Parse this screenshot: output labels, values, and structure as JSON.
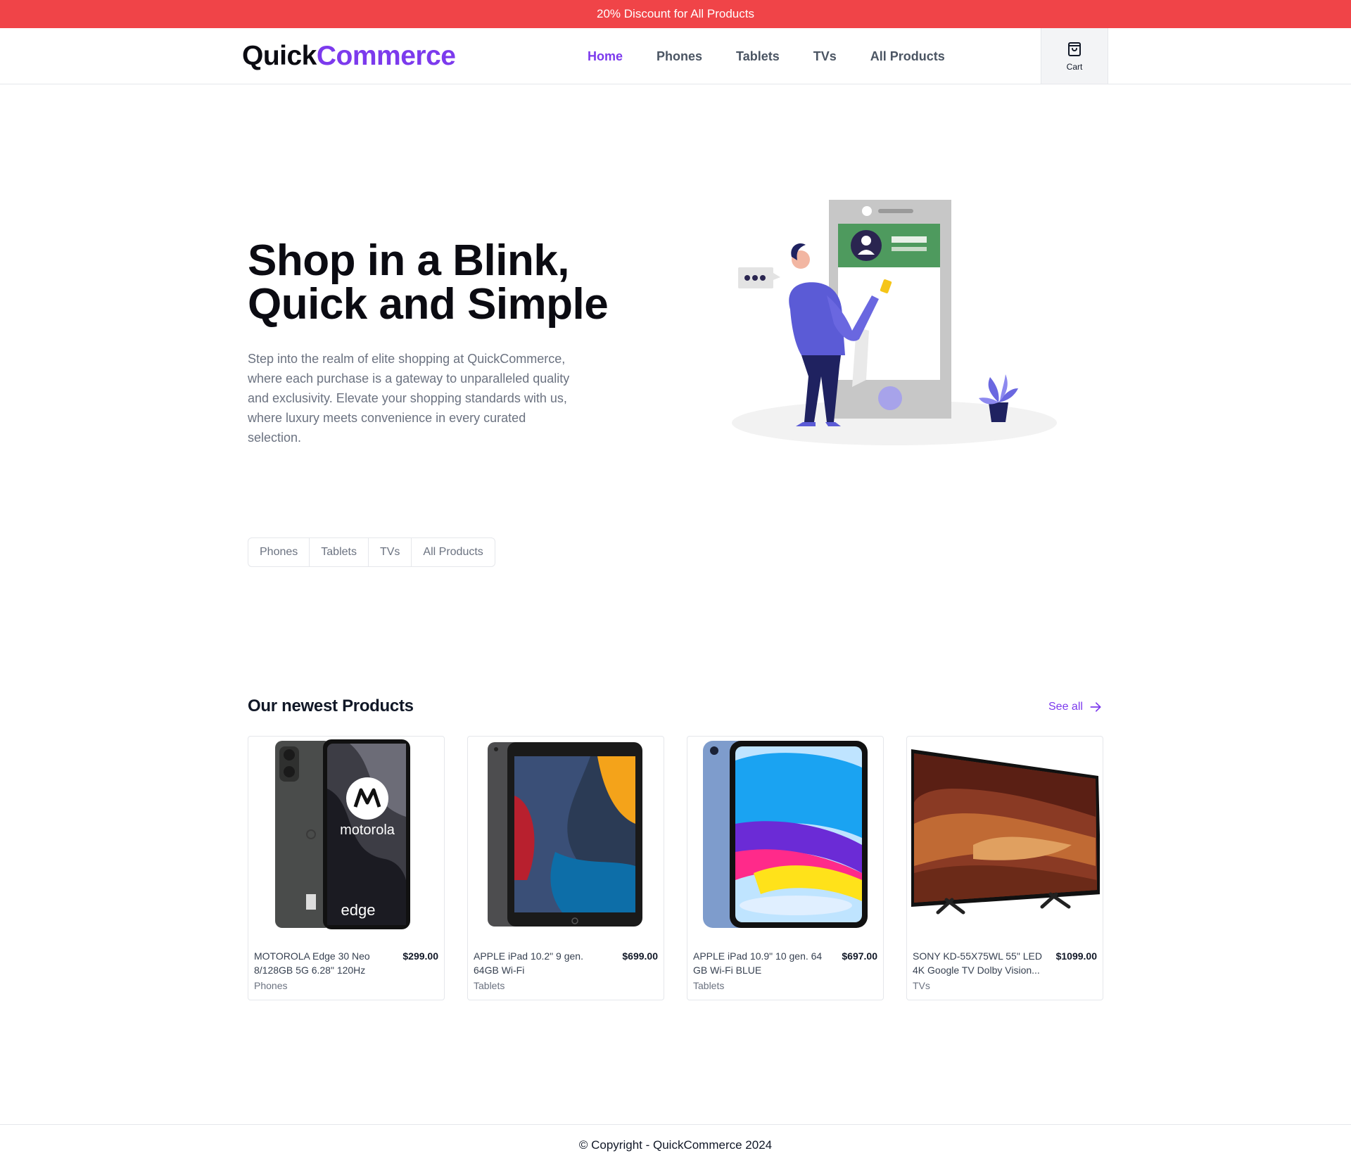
{
  "banner": {
    "text": "20% Discount for All Products"
  },
  "header": {
    "logo_part1": "Quick",
    "logo_part2": "Commerce",
    "nav": [
      {
        "label": "Home",
        "active": true
      },
      {
        "label": "Phones"
      },
      {
        "label": "Tablets"
      },
      {
        "label": "TVs"
      },
      {
        "label": "All Products"
      }
    ],
    "cart_label": "Cart",
    "cart_icon": "shopping-bag-icon"
  },
  "hero": {
    "title_line1": "Shop in a Blink,",
    "title_line2": "Quick and Simple",
    "description": "Step into the realm of elite shopping at QuickCommerce, where each purchase is a gateway to unparalleled quality and exclusivity. Elevate your shopping standards with us, where luxury meets convenience in every curated selection."
  },
  "categories": [
    "Phones",
    "Tablets",
    "TVs",
    "All Products"
  ],
  "newest": {
    "title": "Our newest Products",
    "see_all": "See all",
    "products": [
      {
        "name": "MOTOROLA Edge 30 Neo 8/128GB 5G 6.28\" 120Hz",
        "price": "$299.00",
        "category": "Phones"
      },
      {
        "name": "APPLE iPad 10.2\" 9 gen. 64GB Wi-Fi",
        "price": "$699.00",
        "category": "Tablets"
      },
      {
        "name": "APPLE iPad 10.9\" 10 gen. 64 GB Wi-Fi BLUE",
        "price": "$697.00",
        "category": "Tablets"
      },
      {
        "name": "SONY KD-55X75WL 55\" LED 4K Google TV Dolby Vision...",
        "price": "$1099.00",
        "category": "TVs"
      }
    ],
    "phone_brand": "motorola",
    "phone_model": "edge"
  },
  "footer": {
    "text": "© Copyright - QuickCommerce 2024"
  },
  "colors": {
    "accent": "#7c3aed",
    "banner": "#f04448"
  }
}
